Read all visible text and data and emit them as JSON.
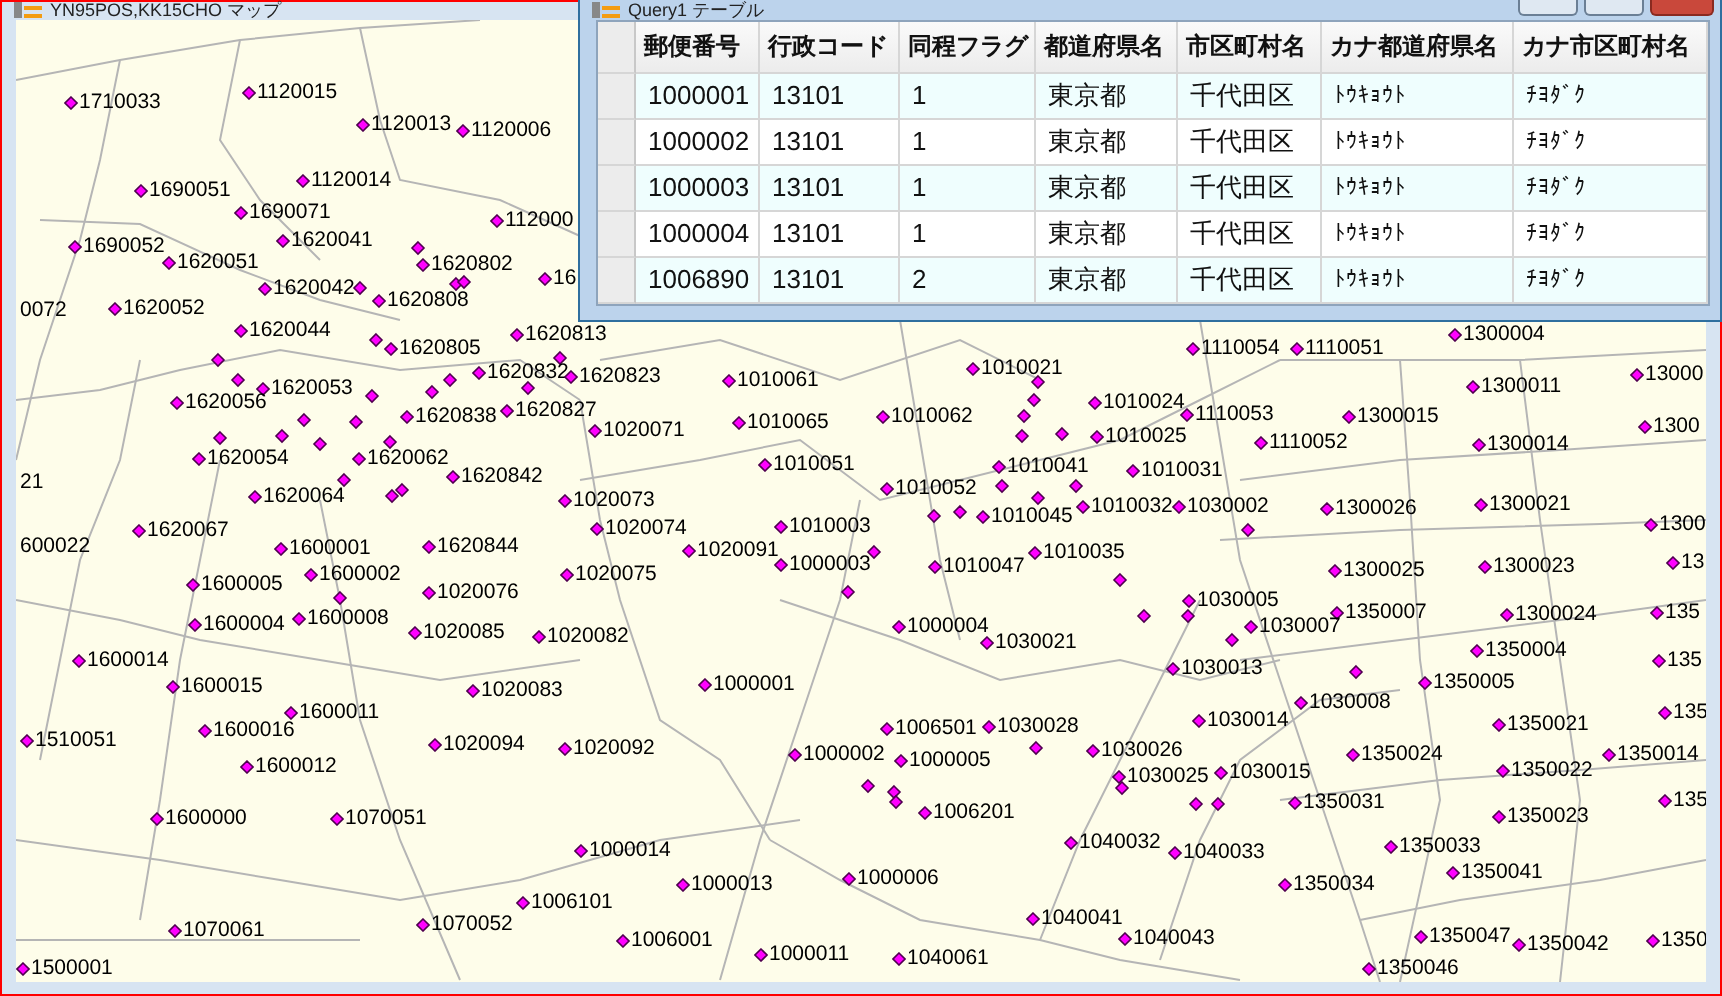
{
  "map_window": {
    "title": "YN95POS,KK15CHO マップ",
    "points": [
      {
        "kind": "point",
        "code": "1710033"
      },
      {
        "kind": "point",
        "code": "1120015"
      },
      {
        "kind": "point",
        "code": "1120013"
      },
      {
        "kind": "point",
        "code": "1120006"
      },
      {
        "kind": "point",
        "code": "1690051"
      },
      {
        "kind": "point",
        "code": "1120014"
      },
      {
        "kind": "point",
        "code": "1690071"
      },
      {
        "kind": "point",
        "code": "112000"
      },
      {
        "kind": "point",
        "code": "1690052"
      },
      {
        "kind": "point",
        "code": "1620041"
      },
      {
        "kind": "point",
        "code": "1620051"
      },
      {
        "kind": "point",
        "code": "1620802"
      },
      {
        "kind": "point",
        "code": "16"
      },
      {
        "kind": "point",
        "code": "1620042"
      },
      {
        "kind": "cut-label",
        "code": "0072"
      },
      {
        "kind": "point",
        "code": "1620052"
      },
      {
        "kind": "point",
        "code": "1620808"
      },
      {
        "kind": "point",
        "code": "1620044"
      },
      {
        "kind": "point",
        "code": "1620813"
      },
      {
        "kind": "point",
        "code": "1300004"
      },
      {
        "kind": "point",
        "code": "1620805"
      },
      {
        "kind": "point",
        "code": "1110054"
      },
      {
        "kind": "point",
        "code": "1110051"
      },
      {
        "kind": "point",
        "code": "1620832"
      },
      {
        "kind": "point",
        "code": "1620823"
      },
      {
        "kind": "point",
        "code": "1010021"
      },
      {
        "kind": "point",
        "code": "13000"
      },
      {
        "kind": "point",
        "code": "1620053"
      },
      {
        "kind": "point",
        "code": "1010061"
      },
      {
        "kind": "point",
        "code": "1300011"
      },
      {
        "kind": "point",
        "code": "1620056"
      },
      {
        "kind": "point",
        "code": "1620827"
      },
      {
        "kind": "point",
        "code": "1010024"
      },
      {
        "kind": "point",
        "code": "1620838"
      },
      {
        "kind": "point",
        "code": "1010065"
      },
      {
        "kind": "point",
        "code": "1010062"
      },
      {
        "kind": "point",
        "code": "1110053"
      },
      {
        "kind": "point",
        "code": "1300015"
      },
      {
        "kind": "point",
        "code": "1020071"
      },
      {
        "kind": "point",
        "code": "1010025"
      },
      {
        "kind": "point",
        "code": "1300"
      },
      {
        "kind": "point",
        "code": "1110052"
      },
      {
        "kind": "point",
        "code": "1300014"
      },
      {
        "kind": "point",
        "code": "1620054"
      },
      {
        "kind": "point",
        "code": "1620062"
      },
      {
        "kind": "point",
        "code": "1010051"
      },
      {
        "kind": "point",
        "code": "1010041"
      },
      {
        "kind": "point",
        "code": "1620842"
      },
      {
        "kind": "point",
        "code": "1010031"
      },
      {
        "kind": "cut-label",
        "code": "21"
      },
      {
        "kind": "point",
        "code": "1010052"
      },
      {
        "kind": "point",
        "code": "1620064"
      },
      {
        "kind": "point",
        "code": "1020073"
      },
      {
        "kind": "point",
        "code": "1010032"
      },
      {
        "kind": "point",
        "code": "1030002"
      },
      {
        "kind": "point",
        "code": "1300021"
      },
      {
        "kind": "point",
        "code": "1010045"
      },
      {
        "kind": "point",
        "code": "1300026"
      },
      {
        "kind": "point",
        "code": "1620067"
      },
      {
        "kind": "point",
        "code": "1020074"
      },
      {
        "kind": "point",
        "code": "1010003"
      },
      {
        "kind": "point",
        "code": "1300"
      },
      {
        "kind": "cut-label",
        "code": "600022"
      },
      {
        "kind": "point",
        "code": "1600001"
      },
      {
        "kind": "point",
        "code": "1620844"
      },
      {
        "kind": "point",
        "code": "1020091"
      },
      {
        "kind": "point",
        "code": "1010035"
      },
      {
        "kind": "point",
        "code": "1000003"
      },
      {
        "kind": "point",
        "code": "1010047"
      },
      {
        "kind": "point",
        "code": "1300025"
      },
      {
        "kind": "point",
        "code": "1300023"
      },
      {
        "kind": "point",
        "code": "13"
      },
      {
        "kind": "point",
        "code": "1600002"
      },
      {
        "kind": "point",
        "code": "1020075"
      },
      {
        "kind": "point",
        "code": "1600005"
      },
      {
        "kind": "point",
        "code": "1020076"
      },
      {
        "kind": "point",
        "code": "1030005"
      },
      {
        "kind": "point",
        "code": "1600008"
      },
      {
        "kind": "point",
        "code": "1350007"
      },
      {
        "kind": "point",
        "code": "1300024"
      },
      {
        "kind": "point",
        "code": "135"
      },
      {
        "kind": "point",
        "code": "1600004"
      },
      {
        "kind": "point",
        "code": "1020085"
      },
      {
        "kind": "point",
        "code": "1000004"
      },
      {
        "kind": "point",
        "code": "1030007"
      },
      {
        "kind": "point",
        "code": "1020082"
      },
      {
        "kind": "point",
        "code": "1030021"
      },
      {
        "kind": "point",
        "code": "1350004"
      },
      {
        "kind": "point",
        "code": "1600014"
      },
      {
        "kind": "point",
        "code": "1030013"
      },
      {
        "kind": "point",
        "code": "135"
      },
      {
        "kind": "point",
        "code": "1600015"
      },
      {
        "kind": "point",
        "code": "1020083"
      },
      {
        "kind": "point",
        "code": "1000001"
      },
      {
        "kind": "point",
        "code": "1350005"
      },
      {
        "kind": "point",
        "code": "1030008"
      },
      {
        "kind": "point",
        "code": "1600011"
      },
      {
        "kind": "point",
        "code": "1030014"
      },
      {
        "kind": "point",
        "code": "135"
      },
      {
        "kind": "point",
        "code": "1600016"
      },
      {
        "kind": "point",
        "code": "1006501"
      },
      {
        "kind": "point",
        "code": "1030028"
      },
      {
        "kind": "point",
        "code": "1350021"
      },
      {
        "kind": "point",
        "code": "1510051"
      },
      {
        "kind": "point",
        "code": "1020094"
      },
      {
        "kind": "point",
        "code": "1020092"
      },
      {
        "kind": "point",
        "code": "1000002"
      },
      {
        "kind": "point",
        "code": "1000005"
      },
      {
        "kind": "point",
        "code": "1030026"
      },
      {
        "kind": "point",
        "code": "1350024"
      },
      {
        "kind": "point",
        "code": "1350014"
      },
      {
        "kind": "point",
        "code": "1600012"
      },
      {
        "kind": "point",
        "code": "1030025"
      },
      {
        "kind": "point",
        "code": "1030015"
      },
      {
        "kind": "point",
        "code": "1350022"
      },
      {
        "kind": "point",
        "code": "1350031"
      },
      {
        "kind": "point",
        "code": "135"
      },
      {
        "kind": "point",
        "code": "1600000"
      },
      {
        "kind": "point",
        "code": "1070051"
      },
      {
        "kind": "point",
        "code": "1006201"
      },
      {
        "kind": "point",
        "code": "1350023"
      },
      {
        "kind": "point",
        "code": "1000014"
      },
      {
        "kind": "point",
        "code": "1040032"
      },
      {
        "kind": "point",
        "code": "1040033"
      },
      {
        "kind": "point",
        "code": "1350033"
      },
      {
        "kind": "point",
        "code": "1000013"
      },
      {
        "kind": "point",
        "code": "1000006"
      },
      {
        "kind": "point",
        "code": "1350034"
      },
      {
        "kind": "point",
        "code": "1350041"
      },
      {
        "kind": "point",
        "code": "1006101"
      },
      {
        "kind": "point",
        "code": "1070061"
      },
      {
        "kind": "point",
        "code": "1070052"
      },
      {
        "kind": "point",
        "code": "1040041"
      },
      {
        "kind": "point",
        "code": "1006001"
      },
      {
        "kind": "point",
        "code": "1040043"
      },
      {
        "kind": "point",
        "code": "1350047"
      },
      {
        "kind": "point",
        "code": "1350042"
      },
      {
        "kind": "point",
        "code": "1350"
      },
      {
        "kind": "point",
        "code": "1000011"
      },
      {
        "kind": "point",
        "code": "1040061"
      },
      {
        "kind": "point",
        "code": "1500001"
      },
      {
        "kind": "point",
        "code": "1350046"
      }
    ]
  },
  "table_window": {
    "title": "Query1 テーブル",
    "columns": [
      "郵便番号",
      "行政コード",
      "同程フラグ",
      "都道府県名",
      "市区町村名",
      "カナ都道府県名",
      "カナ市区町村名"
    ],
    "rows": [
      [
        "1000001",
        "13101",
        "1",
        "東京都",
        "千代田区",
        "ﾄｳｷｮｳﾄ",
        "ﾁﾖﾀﾞｸ"
      ],
      [
        "1000002",
        "13101",
        "1",
        "東京都",
        "千代田区",
        "ﾄｳｷｮｳﾄ",
        "ﾁﾖﾀﾞｸ"
      ],
      [
        "1000003",
        "13101",
        "1",
        "東京都",
        "千代田区",
        "ﾄｳｷｮｳﾄ",
        "ﾁﾖﾀﾞｸ"
      ],
      [
        "1000004",
        "13101",
        "1",
        "東京都",
        "千代田区",
        "ﾄｳｷｮｳﾄ",
        "ﾁﾖﾀﾞｸ"
      ],
      [
        "1006890",
        "13101",
        "2",
        "東京都",
        "千代田区",
        "ﾄｳｷｮｳﾄ",
        "ﾁﾖﾀﾞｸ"
      ]
    ]
  }
}
